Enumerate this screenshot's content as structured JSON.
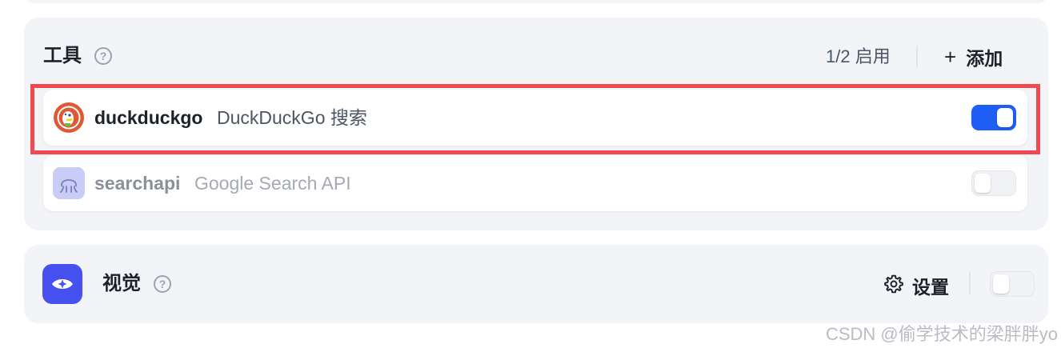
{
  "tools_section": {
    "title": "工具",
    "enabled_count": "1/2 启用",
    "add_label": "添加",
    "tools": [
      {
        "name": "duckduckgo",
        "description": "DuckDuckGo 搜索",
        "icon": "duckduckgo-logo",
        "enabled": true
      },
      {
        "name": "searchapi",
        "description": "Google Search API",
        "icon": "searchapi-logo",
        "enabled": false
      }
    ]
  },
  "vision_section": {
    "title": "视觉",
    "icon": "eye-icon",
    "settings_label": "设置",
    "enabled": false
  },
  "watermark": "CSDN @偷学技术的梁胖胖yo",
  "colors": {
    "accent": "#1e5ef5",
    "highlight": "#ef4a4f",
    "vision_icon_bg": "#4650ee",
    "panel_bg": "#f3f4f7"
  }
}
